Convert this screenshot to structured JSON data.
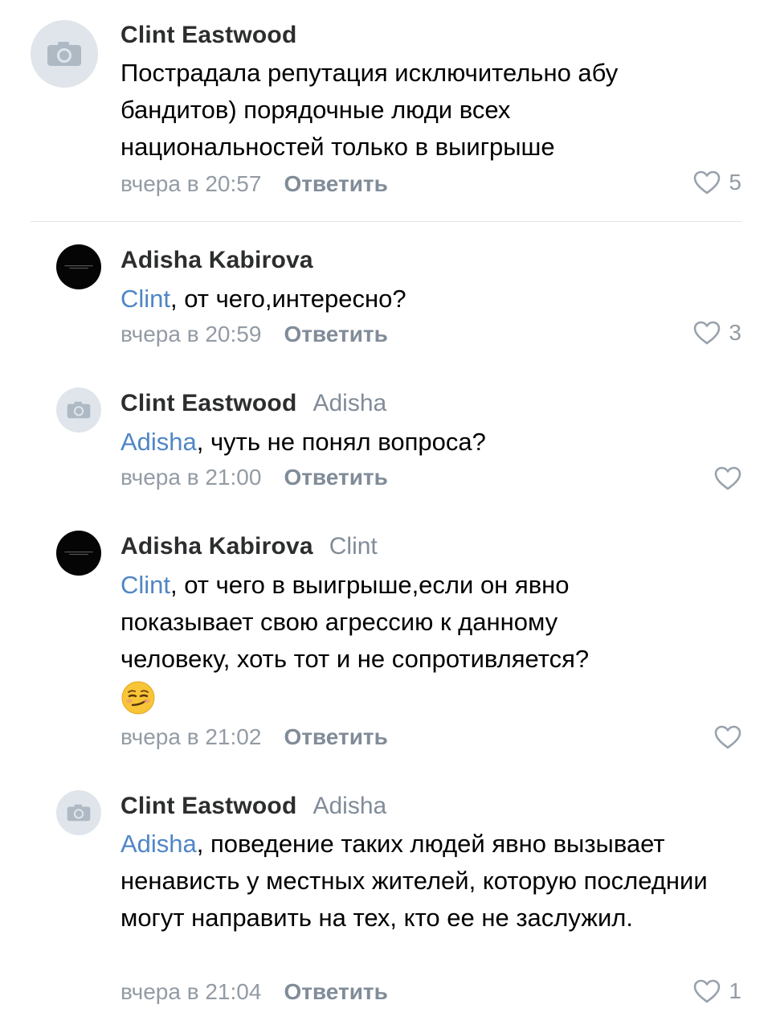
{
  "comments": [
    {
      "author": "Clint Eastwood",
      "reply_to": "",
      "mention": "",
      "text": "Пострадала репутация исключительно абу бандитов) порядочные люди всех национальностей только в выигрыше",
      "time": "вчера в 20:57",
      "reply_label": "Ответить",
      "likes": "5",
      "avatar": "camera-placeholder"
    },
    {
      "author": "Adisha Kabirova",
      "reply_to": "",
      "mention": "Clint",
      "text": ", от чего,интересно?",
      "time": "вчера в 20:59",
      "reply_label": "Ответить",
      "likes": "3",
      "avatar": "dark-photo"
    },
    {
      "author": "Clint Eastwood",
      "reply_to": "Adisha",
      "mention": "Adisha",
      "text": ", чуть не понял вопроса?",
      "time": "вчера в 21:00",
      "reply_label": "Ответить",
      "likes": "",
      "avatar": "camera-placeholder"
    },
    {
      "author": "Adisha Kabirova",
      "reply_to": "Clint",
      "mention": "Clint",
      "text": ", от чего в  выигрыше,если  он явно показывает свою агрессию к данному человеку, хоть тот и не сопротивляется?",
      "emoji": "smirk-emoji",
      "time": "вчера в 21:02",
      "reply_label": "Ответить",
      "likes": "",
      "avatar": "dark-photo"
    },
    {
      "author": "Clint Eastwood",
      "reply_to": "Adisha",
      "mention": "Adisha",
      "text": ", поведение таких людей явно вызывает ненависть у местных жителей, которую последнии могут направить на тех, кто ее не заслужил.",
      "time": "вчера в 21:04",
      "reply_label": "Ответить",
      "likes": "1",
      "avatar": "camera-placeholder"
    }
  ],
  "colors": {
    "author": "#2c2d2e",
    "mention": "#4f86c6",
    "meta": "#939ba4",
    "heart": "#99a2ad"
  }
}
